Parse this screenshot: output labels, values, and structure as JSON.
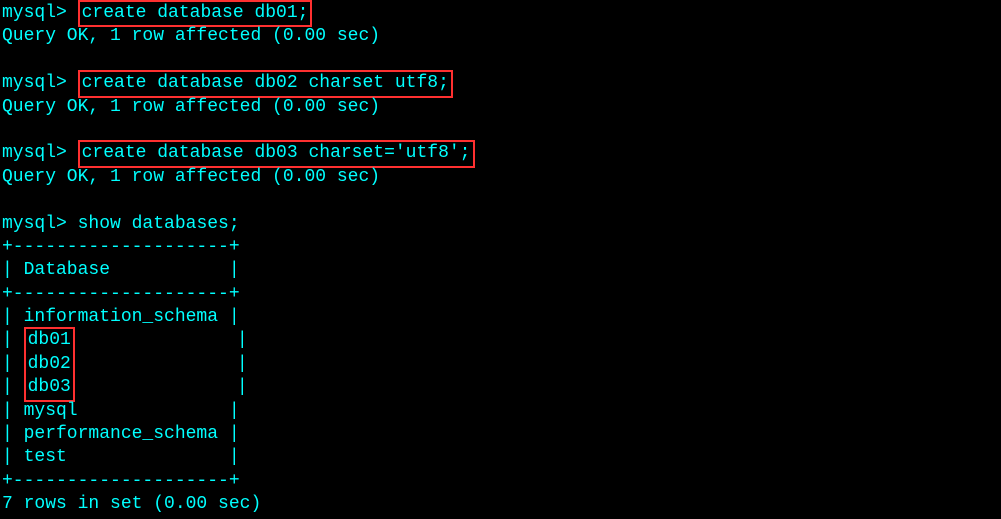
{
  "prompt": "mysql> ",
  "cmd1": "create database db01;",
  "resp1": "Query OK, 1 row affected (0.00 sec)",
  "cmd2": "create database db02 charset utf8;",
  "resp2": "Query OK, 1 row affected (0.00 sec)",
  "cmd3": "create database db03 charset='utf8';",
  "resp3": "Query OK, 1 row affected (0.00 sec)",
  "cmd4": "show databases;",
  "border_top": "+--------------------+",
  "header_row": "| Database           |",
  "border_mid": "+--------------------+",
  "row1": "| information_schema |",
  "row2_prefix": "| ",
  "row2_db": "db01",
  "row2_suffix": "               |",
  "row3_prefix": "| ",
  "row3_db": "db02",
  "row3_suffix": "               |",
  "row4_prefix": "| ",
  "row4_db": "db03",
  "row4_suffix": "               |",
  "row5": "| mysql              |",
  "row6": "| performance_schema |",
  "row7": "| test               |",
  "border_bot": "+--------------------+",
  "footer": "7 rows in set (0.00 sec)"
}
